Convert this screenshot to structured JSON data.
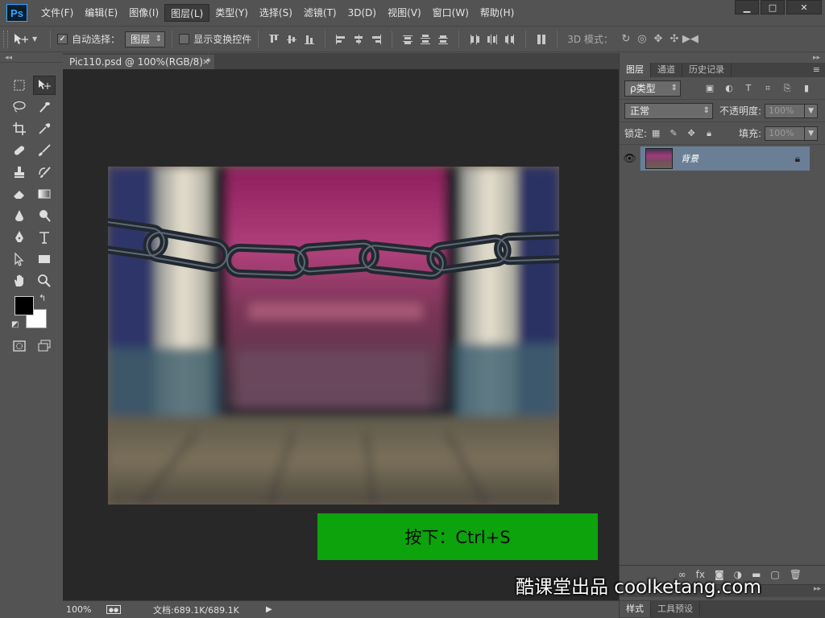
{
  "app": {
    "logo": "Ps"
  },
  "menu": {
    "items": [
      {
        "label": "文件(F)"
      },
      {
        "label": "编辑(E)"
      },
      {
        "label": "图像(I)"
      },
      {
        "label": "图层(L)"
      },
      {
        "label": "类型(Y)"
      },
      {
        "label": "选择(S)"
      },
      {
        "label": "滤镜(T)"
      },
      {
        "label": "3D(D)"
      },
      {
        "label": "视图(V)"
      },
      {
        "label": "窗口(W)"
      },
      {
        "label": "帮助(H)"
      }
    ],
    "active_index": 3
  },
  "window_controls": {
    "minimize": "▁",
    "maximize": "□",
    "close": "✕"
  },
  "options": {
    "auto_select_checked": "✓",
    "auto_select_label": "自动选择：",
    "auto_select_target": "图层",
    "show_transform_label": "显示变换控件",
    "mode_3d_label": "3D 模式："
  },
  "document": {
    "tab_title": "Pic110.psd @ 100%(RGB/8) *",
    "tab_close": "×",
    "zoom": "100%",
    "doc_size": "文档:689.1K/689.1K",
    "status_arrow": "▶"
  },
  "hint": {
    "text": "按下：Ctrl+S"
  },
  "watermark": {
    "text": "酷课堂出品 coolketang.com"
  },
  "layers_panel": {
    "tabs": [
      {
        "label": "图层"
      },
      {
        "label": "通道"
      },
      {
        "label": "历史记录"
      }
    ],
    "filter_kind": "ρ类型",
    "blend_mode": "正常",
    "opacity_label": "不透明度:",
    "opacity_value": "100%",
    "lock_label": "锁定:",
    "fill_label": "填充:",
    "fill_value": "100%",
    "layer_name": "背景"
  },
  "bottom_panel": {
    "tabs": [
      {
        "label": "样式"
      },
      {
        "label": "工具预设"
      }
    ]
  },
  "colors": {
    "accent_green": "#0ca30c",
    "layer_selected": "#6a7f96",
    "ps_blue": "#31a8ff"
  }
}
